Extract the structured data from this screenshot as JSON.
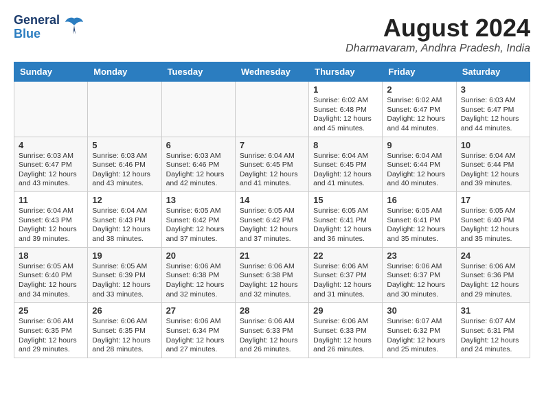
{
  "logo": {
    "line1": "General",
    "line2": "Blue"
  },
  "title": "August 2024",
  "subtitle": "Dharmavaram, Andhra Pradesh, India",
  "days_of_week": [
    "Sunday",
    "Monday",
    "Tuesday",
    "Wednesday",
    "Thursday",
    "Friday",
    "Saturday"
  ],
  "weeks": [
    [
      {
        "day": "",
        "content": ""
      },
      {
        "day": "",
        "content": ""
      },
      {
        "day": "",
        "content": ""
      },
      {
        "day": "",
        "content": ""
      },
      {
        "day": "1",
        "sunrise": "Sunrise: 6:02 AM",
        "sunset": "Sunset: 6:48 PM",
        "daylight": "Daylight: 12 hours and 45 minutes."
      },
      {
        "day": "2",
        "sunrise": "Sunrise: 6:02 AM",
        "sunset": "Sunset: 6:47 PM",
        "daylight": "Daylight: 12 hours and 44 minutes."
      },
      {
        "day": "3",
        "sunrise": "Sunrise: 6:03 AM",
        "sunset": "Sunset: 6:47 PM",
        "daylight": "Daylight: 12 hours and 44 minutes."
      }
    ],
    [
      {
        "day": "4",
        "sunrise": "Sunrise: 6:03 AM",
        "sunset": "Sunset: 6:47 PM",
        "daylight": "Daylight: 12 hours and 43 minutes."
      },
      {
        "day": "5",
        "sunrise": "Sunrise: 6:03 AM",
        "sunset": "Sunset: 6:46 PM",
        "daylight": "Daylight: 12 hours and 43 minutes."
      },
      {
        "day": "6",
        "sunrise": "Sunrise: 6:03 AM",
        "sunset": "Sunset: 6:46 PM",
        "daylight": "Daylight: 12 hours and 42 minutes."
      },
      {
        "day": "7",
        "sunrise": "Sunrise: 6:04 AM",
        "sunset": "Sunset: 6:45 PM",
        "daylight": "Daylight: 12 hours and 41 minutes."
      },
      {
        "day": "8",
        "sunrise": "Sunrise: 6:04 AM",
        "sunset": "Sunset: 6:45 PM",
        "daylight": "Daylight: 12 hours and 41 minutes."
      },
      {
        "day": "9",
        "sunrise": "Sunrise: 6:04 AM",
        "sunset": "Sunset: 6:44 PM",
        "daylight": "Daylight: 12 hours and 40 minutes."
      },
      {
        "day": "10",
        "sunrise": "Sunrise: 6:04 AM",
        "sunset": "Sunset: 6:44 PM",
        "daylight": "Daylight: 12 hours and 39 minutes."
      }
    ],
    [
      {
        "day": "11",
        "sunrise": "Sunrise: 6:04 AM",
        "sunset": "Sunset: 6:43 PM",
        "daylight": "Daylight: 12 hours and 39 minutes."
      },
      {
        "day": "12",
        "sunrise": "Sunrise: 6:04 AM",
        "sunset": "Sunset: 6:43 PM",
        "daylight": "Daylight: 12 hours and 38 minutes."
      },
      {
        "day": "13",
        "sunrise": "Sunrise: 6:05 AM",
        "sunset": "Sunset: 6:42 PM",
        "daylight": "Daylight: 12 hours and 37 minutes."
      },
      {
        "day": "14",
        "sunrise": "Sunrise: 6:05 AM",
        "sunset": "Sunset: 6:42 PM",
        "daylight": "Daylight: 12 hours and 37 minutes."
      },
      {
        "day": "15",
        "sunrise": "Sunrise: 6:05 AM",
        "sunset": "Sunset: 6:41 PM",
        "daylight": "Daylight: 12 hours and 36 minutes."
      },
      {
        "day": "16",
        "sunrise": "Sunrise: 6:05 AM",
        "sunset": "Sunset: 6:41 PM",
        "daylight": "Daylight: 12 hours and 35 minutes."
      },
      {
        "day": "17",
        "sunrise": "Sunrise: 6:05 AM",
        "sunset": "Sunset: 6:40 PM",
        "daylight": "Daylight: 12 hours and 35 minutes."
      }
    ],
    [
      {
        "day": "18",
        "sunrise": "Sunrise: 6:05 AM",
        "sunset": "Sunset: 6:40 PM",
        "daylight": "Daylight: 12 hours and 34 minutes."
      },
      {
        "day": "19",
        "sunrise": "Sunrise: 6:05 AM",
        "sunset": "Sunset: 6:39 PM",
        "daylight": "Daylight: 12 hours and 33 minutes."
      },
      {
        "day": "20",
        "sunrise": "Sunrise: 6:06 AM",
        "sunset": "Sunset: 6:38 PM",
        "daylight": "Daylight: 12 hours and 32 minutes."
      },
      {
        "day": "21",
        "sunrise": "Sunrise: 6:06 AM",
        "sunset": "Sunset: 6:38 PM",
        "daylight": "Daylight: 12 hours and 32 minutes."
      },
      {
        "day": "22",
        "sunrise": "Sunrise: 6:06 AM",
        "sunset": "Sunset: 6:37 PM",
        "daylight": "Daylight: 12 hours and 31 minutes."
      },
      {
        "day": "23",
        "sunrise": "Sunrise: 6:06 AM",
        "sunset": "Sunset: 6:37 PM",
        "daylight": "Daylight: 12 hours and 30 minutes."
      },
      {
        "day": "24",
        "sunrise": "Sunrise: 6:06 AM",
        "sunset": "Sunset: 6:36 PM",
        "daylight": "Daylight: 12 hours and 29 minutes."
      }
    ],
    [
      {
        "day": "25",
        "sunrise": "Sunrise: 6:06 AM",
        "sunset": "Sunset: 6:35 PM",
        "daylight": "Daylight: 12 hours and 29 minutes."
      },
      {
        "day": "26",
        "sunrise": "Sunrise: 6:06 AM",
        "sunset": "Sunset: 6:35 PM",
        "daylight": "Daylight: 12 hours and 28 minutes."
      },
      {
        "day": "27",
        "sunrise": "Sunrise: 6:06 AM",
        "sunset": "Sunset: 6:34 PM",
        "daylight": "Daylight: 12 hours and 27 minutes."
      },
      {
        "day": "28",
        "sunrise": "Sunrise: 6:06 AM",
        "sunset": "Sunset: 6:33 PM",
        "daylight": "Daylight: 12 hours and 26 minutes."
      },
      {
        "day": "29",
        "sunrise": "Sunrise: 6:06 AM",
        "sunset": "Sunset: 6:33 PM",
        "daylight": "Daylight: 12 hours and 26 minutes."
      },
      {
        "day": "30",
        "sunrise": "Sunrise: 6:07 AM",
        "sunset": "Sunset: 6:32 PM",
        "daylight": "Daylight: 12 hours and 25 minutes."
      },
      {
        "day": "31",
        "sunrise": "Sunrise: 6:07 AM",
        "sunset": "Sunset: 6:31 PM",
        "daylight": "Daylight: 12 hours and 24 minutes."
      }
    ]
  ]
}
